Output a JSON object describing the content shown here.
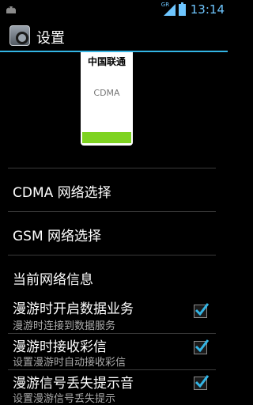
{
  "status_bar": {
    "network_label": "GR",
    "time": "13:14",
    "icons": [
      "android-icon",
      "signal-icon",
      "battery-icon"
    ],
    "accent_color": "#33b5e5"
  },
  "action_bar": {
    "title": "设置",
    "icon": "settings-camera-icon"
  },
  "sim": {
    "operator": "中国联通",
    "type": "CDMA",
    "bar_color": "#7ed321"
  },
  "menu": [
    {
      "title": "CDMA 网络选择"
    },
    {
      "title": "GSM 网络选择"
    },
    {
      "title": "当前网络信息"
    }
  ],
  "toggles": [
    {
      "title": "漫游时开启数据业务",
      "summary": "漫游时连接到数据服务",
      "checked": true
    },
    {
      "title": "漫游时接收彩信",
      "summary": "设置漫游时自动接收彩信",
      "checked": true
    },
    {
      "title": "漫游信号丢失提示音",
      "summary": "设置漫游信号丢失提示",
      "checked": true
    }
  ]
}
